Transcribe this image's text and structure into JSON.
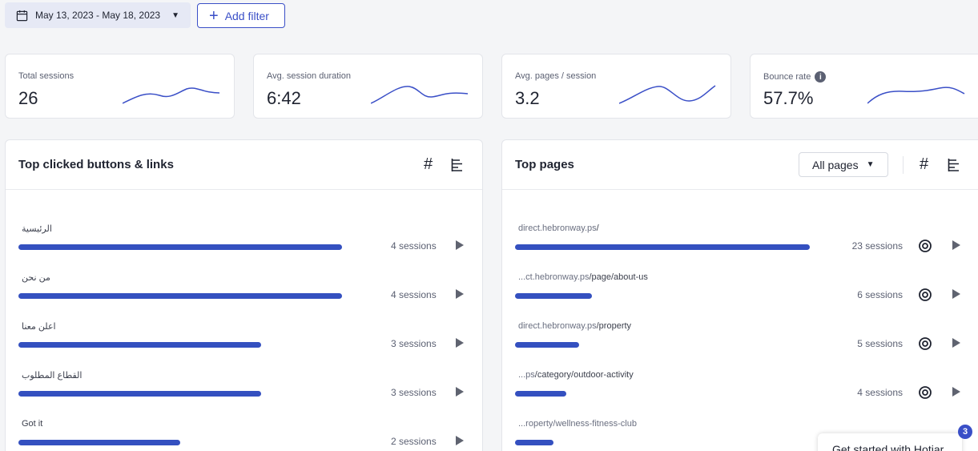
{
  "toolbar": {
    "date_range": "May 13, 2023 - May 18, 2023",
    "add_filter": "Add filter"
  },
  "stats": [
    {
      "label": "Total sessions",
      "value": "26"
    },
    {
      "label": "Avg. session duration",
      "value": "6:42"
    },
    {
      "label": "Avg. pages / session",
      "value": "3.2"
    },
    {
      "label": "Bounce rate",
      "value": "57.7%"
    }
  ],
  "clicked": {
    "title": "Top clicked buttons & links",
    "hash_symbol": "#",
    "rows": [
      {
        "label": "الرئيسية",
        "sessions": "4 sessions",
        "count": 4
      },
      {
        "label": "من نحن",
        "sessions": "4 sessions",
        "count": 4
      },
      {
        "label": "اعلن معنا",
        "sessions": "3 sessions",
        "count": 3
      },
      {
        "label": "القطاع المطلوب",
        "sessions": "3 sessions",
        "count": 3
      },
      {
        "label": "Got it",
        "sessions": "2 sessions",
        "count": 2
      }
    ]
  },
  "pages": {
    "title": "Top pages",
    "filter": "All pages",
    "hash_symbol": "#",
    "rows": [
      {
        "prefix": "direct.hebronway.ps",
        "path": "/",
        "sessions": "23 sessions",
        "count": 23
      },
      {
        "prefix": "...ct.hebronway.ps",
        "path": "/page/about-us",
        "sessions": "6 sessions",
        "count": 6
      },
      {
        "prefix": "direct.hebronway.ps",
        "path": "/property",
        "sessions": "5 sessions",
        "count": 5
      },
      {
        "prefix": "...ps",
        "path": "/category/outdoor-activity",
        "sessions": "4 sessions",
        "count": 4
      },
      {
        "prefix": "...roperty/wellness-fitness-club",
        "path": "",
        "sessions": "",
        "count": 2
      }
    ]
  },
  "toast": {
    "text": "Get started with Hotjar",
    "badge": "3"
  },
  "colors": {
    "accent": "#3a4fc7",
    "bar": "#3450c0"
  }
}
